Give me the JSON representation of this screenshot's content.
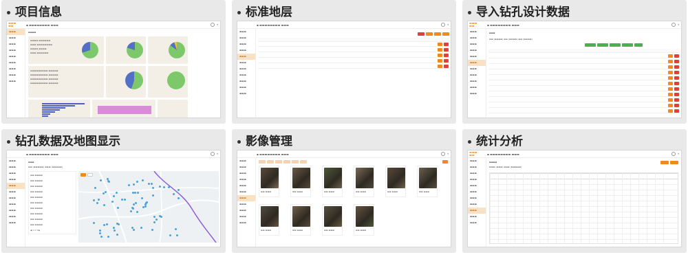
{
  "panels": [
    {
      "title": "项目信息"
    },
    {
      "title": "标准地层"
    },
    {
      "title": "导入钻孔设计数据"
    },
    {
      "title": "钻孔数据及地图显示"
    },
    {
      "title": "影像管理"
    },
    {
      "title": "统计分析"
    }
  ],
  "colors": {
    "accent": "#f08a1c",
    "pie_green": "#7cc86a",
    "pie_blue": "#5470c6",
    "pie_yellow": "#e8c23a",
    "danger": "#e0403a",
    "bar_blue": "#4a5fbf",
    "bar_pink": "#d98ad8",
    "map_dot": "#4aa3d6",
    "route_purple": "#8a5ed6"
  },
  "charts": {
    "p1_pies": [
      {
        "green": 0.7,
        "blue": 0.3
      },
      {
        "green": 0.8,
        "blue": 0.2
      },
      {
        "green": 0.85,
        "blue": 0.1,
        "yellow": 0.05
      },
      {
        "green": 0.55,
        "blue": 0.45
      },
      {
        "green": 1.0
      }
    ],
    "p1_bars": [
      1.0,
      0.78,
      0.55,
      0.42,
      0.3,
      0.2,
      0.14,
      0.08
    ]
  }
}
